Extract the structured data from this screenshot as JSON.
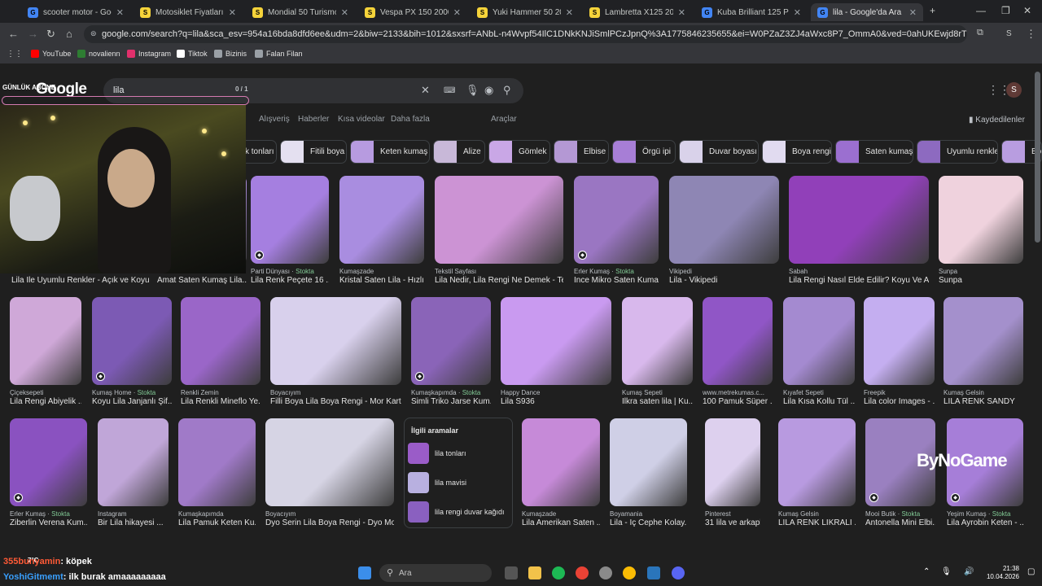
{
  "tabs": [
    {
      "title": "scooter motor - Google'da Ara",
      "fav_color": "#4285f4",
      "fav_letter": "G"
    },
    {
      "title": "Motosiklet Fiyatları, İkinci El",
      "fav_color": "#f5d33a",
      "fav_letter": "S"
    },
    {
      "title": "Mondial 50 Turismo 2026",
      "fav_color": "#f5d33a",
      "fav_letter": "S"
    },
    {
      "title": "Vespa PX 150 2000 Model",
      "fav_color": "#f5d33a",
      "fav_letter": "S"
    },
    {
      "title": "Yuki Hammer 50 2026 Model",
      "fav_color": "#f5d33a",
      "fav_letter": "S"
    },
    {
      "title": "Lambretta X125 2024 Model",
      "fav_color": "#f5d33a",
      "fav_letter": "S"
    },
    {
      "title": "Kuba Brilliant 125 Pro - Google",
      "fav_color": "#4285f4",
      "fav_letter": "G"
    },
    {
      "title": "lila - Google'da Ara",
      "fav_color": "#4285f4",
      "fav_letter": "G"
    }
  ],
  "url": "google.com/search?q=lila&sca_esv=954a16bda8dfd6ee&udm=2&biw=2133&bih=1012&sxsrf=ANbL-n4Wvpf54IlC1DNkKNJiSmlPCzJpnQ%3A1775846235655&ei=W0PZaZ3ZJ4aWxc8P7_OmmA0&ved=0ahUKEwjd8rTg9uOTAxUGS_EDHe-5CdM...",
  "bookmarks": [
    {
      "label": "YouTube",
      "color": "#ff0000"
    },
    {
      "label": "novalienn",
      "color": "#2e7d32"
    },
    {
      "label": "Instagram",
      "color": "#e1306c"
    },
    {
      "label": "Tiktok",
      "color": "#ffffff"
    },
    {
      "label": "Bizinis",
      "color": "#9aa0a6"
    },
    {
      "label": "Falan Filan",
      "color": "#9aa0a6"
    }
  ],
  "search": {
    "logo": "Google",
    "query": "lila",
    "find_count": "0 / 1"
  },
  "filters": [
    {
      "label": "Alışveriş"
    },
    {
      "label": "Haberler"
    },
    {
      "label": "Kısa videolar"
    },
    {
      "label": "Daha fazla"
    },
    {
      "label": "Araçlar"
    }
  ],
  "saved_label": "Kaydedilenler",
  "avatar_letter": "S",
  "chips": [
    {
      "label": "k tonları",
      "color": "#9b6bd8"
    },
    {
      "label": "Fitili boya",
      "color": "#e4e0f0"
    },
    {
      "label": "Keten kumaş",
      "color": "#b79be0"
    },
    {
      "label": "Alize",
      "color": "#c8b8d8"
    },
    {
      "label": "Gömlek",
      "color": "#c9a7e6"
    },
    {
      "label": "Elbise",
      "color": "#b498d4"
    },
    {
      "label": "Örgü ipi",
      "color": "#a77ed6"
    },
    {
      "label": "Duvar boyası",
      "color": "#d9d2ea"
    },
    {
      "label": "Boya rengi",
      "color": "#e1dbf0"
    },
    {
      "label": "Saten kumaş",
      "color": "#9b6fd0"
    },
    {
      "label": "Uyumlu renkler",
      "color": "#8d6ac0"
    },
    {
      "label": "Bo",
      "color": "#b89de0"
    }
  ],
  "row1": [
    {
      "source": "",
      "stock": "",
      "title": "Lila İle Uyumlu Renkler - Açık ve Koyu ...",
      "color": "#b28fe0"
    },
    {
      "source": "",
      "stock": "",
      "title": "Amat Saten Kumaş Lila...",
      "color": "#a88ad8"
    },
    {
      "source": "Parti Dünyası",
      "stock": "Stokta",
      "title": "Lila Renk Peçete 16 ...",
      "color": "#a57fe0"
    },
    {
      "source": "Kumaşzade",
      "stock": "",
      "title": "Kristal Saten Lila - Hızlı...",
      "color": "#a98de0"
    },
    {
      "source": "Tekstil Sayfası",
      "stock": "",
      "title": "Lila Nedir, Lila Rengi Ne Demek - Tek...",
      "color": "#cc93d4"
    },
    {
      "source": "Erler Kumaş",
      "stock": "Stokta",
      "title": "İnce Mikro Saten Kuma...",
      "color": "#9a76c2"
    },
    {
      "source": "Vikipedi",
      "stock": "",
      "title": "Lila - Vikipedi",
      "color": "#8e86b4"
    },
    {
      "source": "Sabah",
      "stock": "",
      "title": "Lila Rengi Nasıl Elde Edilir? Koyu Ve Aç...",
      "color": "#9140b9"
    },
    {
      "source": "Sunpa",
      "stock": "",
      "title": "Sunpa",
      "color": "#efd2dd"
    }
  ],
  "row2": [
    {
      "source": "Çiçeksepeti",
      "stock": "",
      "title": "Lila Rengi Abiyelik ...",
      "color": "#cfa8d8"
    },
    {
      "source": "Kumaş Home",
      "stock": "Stokta",
      "title": "Koyu Lila Janjanlı Şif...",
      "color": "#7c5ab4"
    },
    {
      "source": "Renkli Zemin",
      "stock": "",
      "title": "Lila Renkli Mineflo Ye...",
      "color": "#9a66c8"
    },
    {
      "source": "Boyacıyım",
      "stock": "",
      "title": "Filli Boya Lila Boya Rengi - Mor Kartel...",
      "color": "#d8d0ec"
    },
    {
      "source": "Kumaşkapımda",
      "stock": "Stokta",
      "title": "Simli Triko Jarse Kum...",
      "color": "#8a64b8"
    },
    {
      "source": "Happy Dance",
      "stock": "",
      "title": "Lila S936",
      "color": "#c99af0"
    },
    {
      "source": "Kumaş Sepeti",
      "stock": "",
      "title": "İlkra saten lila | Ku...",
      "color": "#d8b8ec"
    },
    {
      "source": "www.metrekumas.c...",
      "stock": "",
      "title": "100 Pamuk Süper ...",
      "color": "#9056c6"
    },
    {
      "source": "Kıyafet Sepeti",
      "stock": "",
      "title": "Lila Kısa Kollu Tül ...",
      "color": "#a48ad0"
    },
    {
      "source": "Freepik",
      "stock": "",
      "title": "Lila color Images - ...",
      "color": "#c4aef0"
    },
    {
      "source": "Kumaş Gelsin",
      "stock": "",
      "title": "LİLA RENK SANDY",
      "color": "#a490cc"
    }
  ],
  "row3": [
    {
      "source": "Erler Kumaş",
      "stock": "Stokta",
      "title": "Ziberlin Verena Kum...",
      "color": "#8a52c0"
    },
    {
      "source": "Instagram",
      "stock": "",
      "title": "Bir Lila hikayesi ...",
      "color": "#c0a6d8"
    },
    {
      "source": "Kumaşkapımda",
      "stock": "",
      "title": "Lila Pamuk Keten Ku...",
      "color": "#a07ac8"
    },
    {
      "source": "Boyacıyım",
      "stock": "",
      "title": "Dyo Serin Lila Boya Rengi - Dyo Mor ...",
      "color": "#d6d4e4"
    },
    {
      "source": "Kumaşzade",
      "stock": "",
      "title": "Lila Amerikan Saten ...",
      "color": "#c68ad8"
    },
    {
      "source": "Boyamania",
      "stock": "",
      "title": "Lila - İç Cephe Kolay...",
      "color": "#cfcfe6"
    },
    {
      "source": "Pinterest",
      "stock": "",
      "title": "31 lila ve arkaplan ...",
      "color": "#ddd0ee"
    },
    {
      "source": "Kumaş Gelsin",
      "stock": "",
      "title": "LİLA RENK LİKRALI ...",
      "color": "#b89ae0"
    },
    {
      "source": "Mooi Butik",
      "stock": "Stokta",
      "title": "Antonella Mini Elbi...",
      "color": "#9a80c0"
    },
    {
      "source": "Yeşim Kumaş",
      "stock": "Stokta",
      "title": "Lila Ayrobin Keten - ...",
      "color": "#a67ed8"
    }
  ],
  "related": {
    "header": "İlgili aramalar",
    "items": [
      {
        "label": "lila tonları",
        "color": "#9a5cc8"
      },
      {
        "label": "lila mavisi",
        "color": "#b8b0e0"
      },
      {
        "label": "lila rengi duvar kağıdı",
        "color": "#8a60c0"
      }
    ]
  },
  "stream": {
    "overlay_title": "GÜNLÜK ABONE",
    "watermark": "ByNoGame",
    "chat": [
      {
        "user": "355bunyamin",
        "text": "köpek"
      },
      {
        "user": "YoshiGitmemt",
        "text": "ilk burak amaaaaaaaaa"
      }
    ]
  },
  "taskbar": {
    "search_label": "Ara",
    "time": "21:38",
    "date": "10.04.2026",
    "temp": "7°C"
  }
}
